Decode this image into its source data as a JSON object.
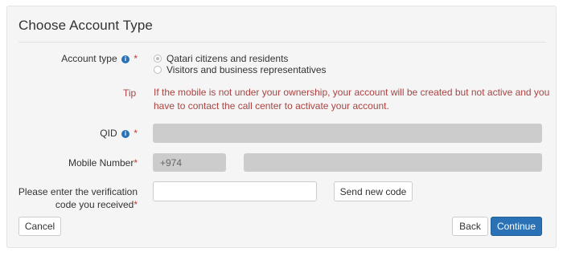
{
  "title": "Choose Account Type",
  "account_type": {
    "label": "Account type",
    "required_mark": "*",
    "info_icon": "info-icon",
    "options": [
      {
        "label": "Qatari citizens and residents",
        "selected": true
      },
      {
        "label": "Visitors and business representatives",
        "selected": false
      }
    ]
  },
  "tip": {
    "label": "Tip",
    "line1": "If the mobile is not under your ownership, your account will be created but not active and you",
    "line2": "have to contact the call center to activate your account."
  },
  "qid": {
    "label": "QID",
    "required_mark": "*",
    "info_icon": "info-icon",
    "value": ""
  },
  "mobile": {
    "label": "Mobile Number",
    "required_mark": "*",
    "country_code": "+974",
    "value": ""
  },
  "verification": {
    "label_line1": "Please enter the verification",
    "label_line2": "code you received",
    "required_mark": "*",
    "value": "",
    "send_button": "Send new code"
  },
  "buttons": {
    "cancel": "Cancel",
    "back": "Back",
    "continue": "Continue"
  },
  "colors": {
    "primary": "#2a72b5",
    "error_text": "#a94442",
    "required": "#c0392b"
  }
}
